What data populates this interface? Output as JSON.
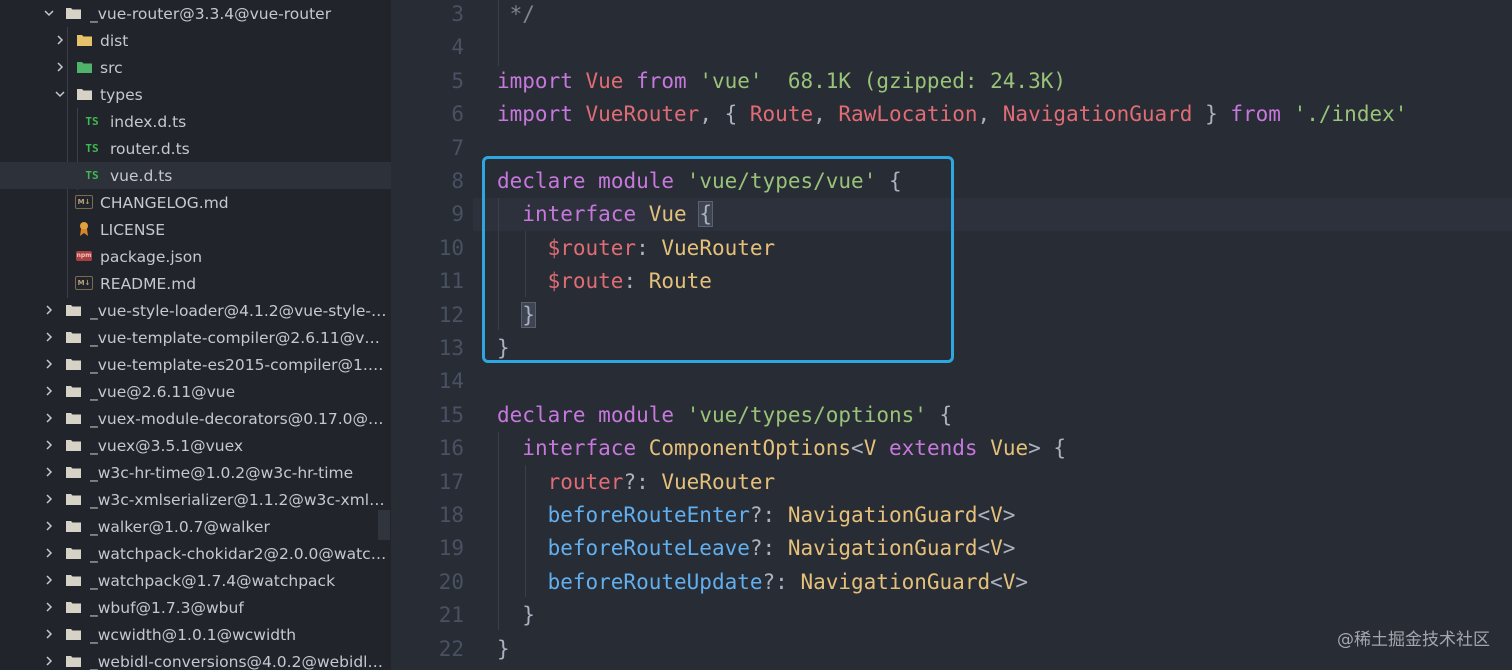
{
  "sidebar": {
    "items": [
      {
        "label": "_vue-router@3.3.4@vue-router",
        "type": "folder-open",
        "chevron": "down",
        "level": 0
      },
      {
        "label": "dist",
        "type": "folder-dist",
        "chevron": "right",
        "level": 1
      },
      {
        "label": "src",
        "type": "folder-src",
        "chevron": "right",
        "level": 1
      },
      {
        "label": "types",
        "type": "folder-open",
        "chevron": "down",
        "level": 1
      },
      {
        "label": "index.d.ts",
        "type": "ts",
        "icon_text": "TS",
        "level": 2
      },
      {
        "label": "router.d.ts",
        "type": "ts",
        "icon_text": "TS",
        "level": 2
      },
      {
        "label": "vue.d.ts",
        "type": "ts",
        "icon_text": "TS",
        "level": 2,
        "selected": true
      },
      {
        "label": "CHANGELOG.md",
        "type": "md",
        "icon_text": "M↓",
        "level": 1
      },
      {
        "label": "LICENSE",
        "type": "license",
        "level": 1
      },
      {
        "label": "package.json",
        "type": "json",
        "icon_text": "npm",
        "level": 1
      },
      {
        "label": "README.md",
        "type": "md",
        "icon_text": "M↓",
        "level": 1
      },
      {
        "label": "_vue-style-loader@4.1.2@vue-style-l...",
        "type": "folder",
        "chevron": "right",
        "level": 0
      },
      {
        "label": "_vue-template-compiler@2.6.11@vue-...",
        "type": "folder",
        "chevron": "right",
        "level": 0
      },
      {
        "label": "_vue-template-es2015-compiler@1.9....",
        "type": "folder",
        "chevron": "right",
        "level": 0
      },
      {
        "label": "_vue@2.6.11@vue",
        "type": "folder",
        "chevron": "right",
        "level": 0
      },
      {
        "label": "_vuex-module-decorators@0.17.0@vu...",
        "type": "folder",
        "chevron": "right",
        "level": 0
      },
      {
        "label": "_vuex@3.5.1@vuex",
        "type": "folder",
        "chevron": "right",
        "level": 0
      },
      {
        "label": "_w3c-hr-time@1.0.2@w3c-hr-time",
        "type": "folder",
        "chevron": "right",
        "level": 0
      },
      {
        "label": "_w3c-xmlserializer@1.1.2@w3c-xmlse...",
        "type": "folder",
        "chevron": "right",
        "level": 0
      },
      {
        "label": "_walker@1.0.7@walker",
        "type": "folder",
        "chevron": "right",
        "level": 0
      },
      {
        "label": "_watchpack-chokidar2@2.0.0@watch...",
        "type": "folder",
        "chevron": "right",
        "level": 0
      },
      {
        "label": "_watchpack@1.7.4@watchpack",
        "type": "folder",
        "chevron": "right",
        "level": 0
      },
      {
        "label": "_wbuf@1.7.3@wbuf",
        "type": "folder",
        "chevron": "right",
        "level": 0
      },
      {
        "label": "_wcwidth@1.0.1@wcwidth",
        "type": "folder",
        "chevron": "right",
        "level": 0
      },
      {
        "label": "_webidl-conversions@4.0.2@webidl-c...",
        "type": "folder",
        "chevron": "right",
        "level": 0
      }
    ]
  },
  "editor": {
    "lines": [
      {
        "n": "3",
        "tokens": [
          [
            "cm",
            " */"
          ]
        ]
      },
      {
        "n": "4",
        "tokens": []
      },
      {
        "n": "5",
        "tokens": [
          [
            "kw",
            "import"
          ],
          [
            "pn",
            " "
          ],
          [
            "var",
            "Vue"
          ],
          [
            "pn",
            " "
          ],
          [
            "kw",
            "from"
          ],
          [
            "pn",
            " "
          ],
          [
            "str",
            "'vue'"
          ],
          [
            "pn",
            "  "
          ],
          [
            "sz",
            "68.1K (gzipped: 24.3K)"
          ]
        ]
      },
      {
        "n": "6",
        "tokens": [
          [
            "kw",
            "import"
          ],
          [
            "pn",
            " "
          ],
          [
            "var",
            "VueRouter"
          ],
          [
            "pn",
            ", { "
          ],
          [
            "var",
            "Route"
          ],
          [
            "pn",
            ", "
          ],
          [
            "var",
            "RawLocation"
          ],
          [
            "pn",
            ", "
          ],
          [
            "var",
            "NavigationGuard"
          ],
          [
            "pn",
            " } "
          ],
          [
            "kw",
            "from"
          ],
          [
            "pn",
            " "
          ],
          [
            "str",
            "'./index'"
          ]
        ]
      },
      {
        "n": "7",
        "tokens": []
      },
      {
        "n": "8",
        "tokens": [
          [
            "kw",
            "declare"
          ],
          [
            "pn",
            " "
          ],
          [
            "kw",
            "module"
          ],
          [
            "pn",
            " "
          ],
          [
            "str",
            "'vue/types/vue'"
          ],
          [
            "pn",
            " {"
          ]
        ]
      },
      {
        "n": "9",
        "tokens": [
          [
            "pn",
            "  "
          ],
          [
            "kw",
            "interface"
          ],
          [
            "pn",
            " "
          ],
          [
            "typ",
            "Vue"
          ],
          [
            "pn",
            " "
          ],
          [
            "bh",
            "{"
          ]
        ]
      },
      {
        "n": "10",
        "tokens": [
          [
            "pn",
            "    "
          ],
          [
            "var",
            "$router"
          ],
          [
            "pn",
            ": "
          ],
          [
            "typ",
            "VueRouter"
          ]
        ]
      },
      {
        "n": "11",
        "tokens": [
          [
            "pn",
            "    "
          ],
          [
            "var",
            "$route"
          ],
          [
            "pn",
            ": "
          ],
          [
            "typ",
            "Route"
          ]
        ]
      },
      {
        "n": "12",
        "tokens": [
          [
            "pn",
            "  "
          ],
          [
            "bh",
            "}"
          ]
        ]
      },
      {
        "n": "13",
        "tokens": [
          [
            "pn",
            "}"
          ]
        ]
      },
      {
        "n": "14",
        "tokens": []
      },
      {
        "n": "15",
        "tokens": [
          [
            "kw",
            "declare"
          ],
          [
            "pn",
            " "
          ],
          [
            "kw",
            "module"
          ],
          [
            "pn",
            " "
          ],
          [
            "str",
            "'vue/types/options'"
          ],
          [
            "pn",
            " {"
          ]
        ]
      },
      {
        "n": "16",
        "tokens": [
          [
            "pn",
            "  "
          ],
          [
            "kw",
            "interface"
          ],
          [
            "pn",
            " "
          ],
          [
            "typ",
            "ComponentOptions"
          ],
          [
            "pn",
            "<"
          ],
          [
            "typ",
            "V"
          ],
          [
            "pn",
            " "
          ],
          [
            "kw",
            "extends"
          ],
          [
            "pn",
            " "
          ],
          [
            "typ",
            "Vue"
          ],
          [
            "pn",
            "> {"
          ]
        ]
      },
      {
        "n": "17",
        "tokens": [
          [
            "pn",
            "    "
          ],
          [
            "var",
            "router"
          ],
          [
            "pn",
            "?: "
          ],
          [
            "typ",
            "VueRouter"
          ]
        ]
      },
      {
        "n": "18",
        "tokens": [
          [
            "pn",
            "    "
          ],
          [
            "fn",
            "beforeRouteEnter"
          ],
          [
            "pn",
            "?: "
          ],
          [
            "typ",
            "NavigationGuard"
          ],
          [
            "pn",
            "<"
          ],
          [
            "typ",
            "V"
          ],
          [
            "pn",
            ">"
          ]
        ]
      },
      {
        "n": "19",
        "tokens": [
          [
            "pn",
            "    "
          ],
          [
            "fn",
            "beforeRouteLeave"
          ],
          [
            "pn",
            "?: "
          ],
          [
            "typ",
            "NavigationGuard"
          ],
          [
            "pn",
            "<"
          ],
          [
            "typ",
            "V"
          ],
          [
            "pn",
            ">"
          ]
        ]
      },
      {
        "n": "20",
        "tokens": [
          [
            "pn",
            "    "
          ],
          [
            "fn",
            "beforeRouteUpdate"
          ],
          [
            "pn",
            "?: "
          ],
          [
            "typ",
            "NavigationGuard"
          ],
          [
            "pn",
            "<"
          ],
          [
            "typ",
            "V"
          ],
          [
            "pn",
            ">"
          ]
        ]
      },
      {
        "n": "21",
        "tokens": [
          [
            "pn",
            "  }"
          ]
        ]
      },
      {
        "n": "22",
        "tokens": [
          [
            "pn",
            "}"
          ]
        ]
      }
    ]
  },
  "watermark": "@稀土掘金技术社区"
}
